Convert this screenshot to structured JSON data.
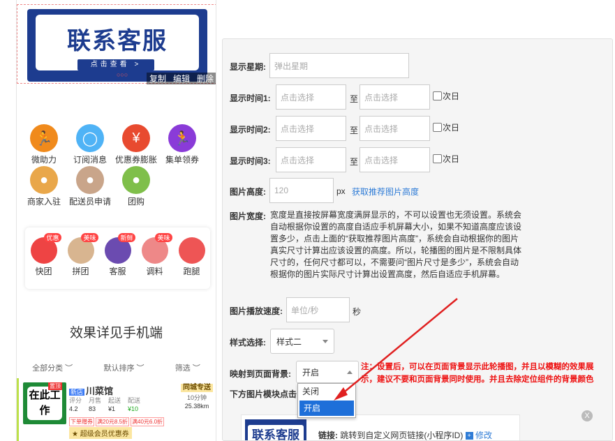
{
  "banner": {
    "title": "联系客服",
    "button": "点击查看 >",
    "dots": "○○○",
    "actions": [
      "复制",
      "编辑",
      "删除"
    ]
  },
  "icons": [
    {
      "label": "微助力",
      "color": "#f08a1c",
      "icon": "runner-icon"
    },
    {
      "label": "订阅消息",
      "color": "#4fb3f6",
      "icon": "shield-icon"
    },
    {
      "label": "优惠券膨胀",
      "color": "#e84a2f",
      "icon": "coupon-icon"
    },
    {
      "label": "集单领券",
      "color": "#8a3bd8",
      "icon": "runner-icon"
    },
    {
      "label": "商家入驻",
      "color": "#e9a74a",
      "icon": "food-icon"
    },
    {
      "label": "配送员申请",
      "color": "#c9a58a",
      "icon": "food-icon"
    },
    {
      "label": "团购",
      "color": "#7fbf4a",
      "icon": "food-icon"
    }
  ],
  "row2": [
    {
      "label": "快团",
      "badge": "优惠",
      "color": "#e44"
    },
    {
      "label": "拼团",
      "badge": "美味",
      "color": "#d8b590"
    },
    {
      "label": "客服",
      "badge": "新鲜",
      "color": "#6b4bb0"
    },
    {
      "label": "调料",
      "badge": "美味",
      "color": "#e88"
    },
    {
      "label": "跑腿",
      "badge": "",
      "color": "#e55"
    }
  ],
  "effect_text": "效果详见手机端",
  "filters": [
    "全部分类 ︶",
    "默认排序 ︶",
    "筛选 ︶"
  ],
  "shop": {
    "img_text": "在此工作",
    "tag": "置顶",
    "new_badge": "新店",
    "name": "川菜馆",
    "stats": [
      {
        "k": "评分",
        "v": "4.2"
      },
      {
        "k": "月售",
        "v": "83"
      },
      {
        "k": "起送",
        "v": "¥1"
      },
      {
        "k": "配送",
        "v": "¥10"
      }
    ],
    "delivery": "同城专送",
    "time": "10分钟",
    "distance": "25.38km",
    "coupons": [
      "下单赠券",
      "满20元8.5折",
      "满40元6.0折"
    ],
    "member": "超级会员优惠券"
  },
  "form": {
    "weekday_label": "显示星期:",
    "weekday_placeholder": "弹出星期",
    "time_rows": [
      {
        "label": "显示时间1:",
        "from": "点击选择",
        "to_label": "至",
        "to": "点击选择",
        "next_day": "次日"
      },
      {
        "label": "显示时间2:",
        "from": "点击选择",
        "to_label": "至",
        "to": "点击选择",
        "next_day": "次日"
      },
      {
        "label": "显示时间3:",
        "from": "点击选择",
        "to_label": "至",
        "to": "点击选择",
        "next_day": "次日"
      }
    ],
    "height_label": "图片高度:",
    "height_value": "120",
    "height_unit": "px",
    "height_link": "获取推荐图片高度",
    "width_label": "图片宽度:",
    "width_desc": "宽度是直接按屏幕宽度满屏显示的，不可以设置也无须设置。系统会自动根据你设置的高度自适应手机屏幕大小，如果不知道高度应该设置多少，点击上面的“获取推荐图片高度”，系统会自动根据你的图片真实尺寸计算出应该设置的高度。所以，轮播图的图片是不限制具体尺寸的，任何尺寸都可以，不需要问“图片尺寸是多少”，系统会自动根据你的图片实际尺寸计算出设置高度，然后自适应手机屏幕。",
    "speed_label": "图片播放速度:",
    "speed_placeholder": "单位/秒",
    "speed_unit": "秒",
    "style_label": "样式选择:",
    "style_value": "样式二",
    "bg_label": "映射到页面背景:",
    "bg_value": "开启",
    "bg_options": [
      "关闭",
      "开启"
    ],
    "bg_note": "注：设置后，可以在页面背景显示此轮播图，并且以模糊的效果展示，建议不要和页面背景同时使用。并且去除定位组件的背景颜色",
    "below_label": "下方图片模块点击",
    "card_img_text": "联系客服",
    "card_link_label": "链接:",
    "card_link_text": "跳转到自定义网页链接(小程序ID)",
    "card_edit": "修改",
    "close_text": "X"
  },
  "colors": {
    "accent": "#1e6fd9",
    "note": "#e11",
    "arrow": "#e02020"
  }
}
